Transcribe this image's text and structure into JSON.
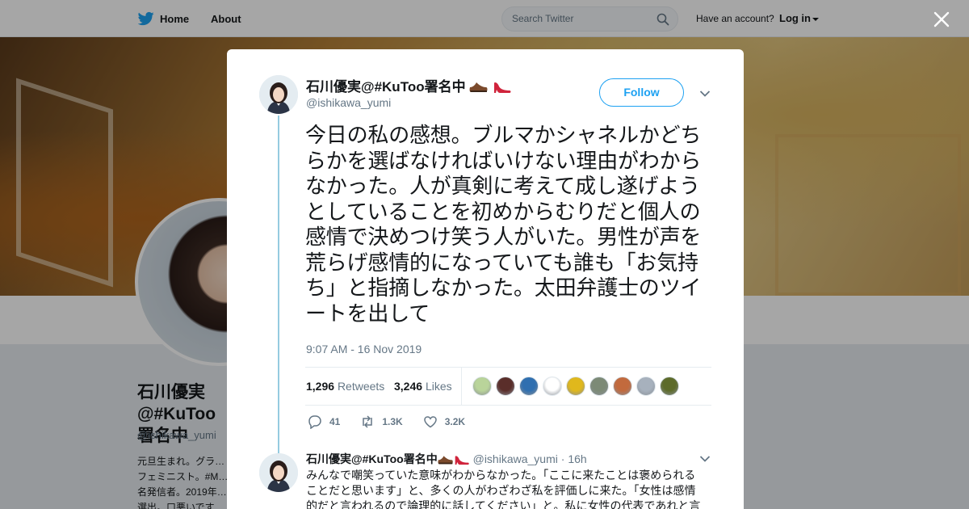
{
  "topbar": {
    "home_label": "Home",
    "about_label": "About",
    "search_placeholder": "Search Twitter",
    "have_account": "Have an account?",
    "login_label": "Log in"
  },
  "profile": {
    "name": "石川優実@#KuToo署名中",
    "handle": "@ishikawa_yumi",
    "bio": "元旦生まれ。グラ… フェミニスト。#M… 名発信者。2019年… 選出。口悪いです…"
  },
  "tweet": {
    "author_name": "石川優実@#KuToo署名中",
    "author_handle": "@ishikawa_yumi",
    "follow_label": "Follow",
    "text": "今日の私の感想。ブルマかシャネルかどちらかを選ばなければいけない理由がわからなかった。人が真剣に考えて成し遂げようとしていることを初めからむりだと個人の感情で決めつけ笑う人がいた。男性が声を荒らげ感情的になっていても誰も「お気持ち」と指摘しなかった。太田弁護士のツイートを出して",
    "timestamp": "9:07 AM - 16 Nov 2019",
    "retweets_count": "1,296",
    "retweets_label": "Retweets",
    "likes_count": "3,246",
    "likes_label": "Likes",
    "reply_count": "41",
    "retweet_action_count": "1.3K",
    "like_action_count": "3.2K",
    "likers": [
      "#b9d49a",
      "#5a2e2a",
      "#2f6fb0",
      "#ffffff",
      "#e0b81c",
      "#7c8a76",
      "#c26a3d",
      "#a7b1bd",
      "#5d6b2a"
    ]
  },
  "reply": {
    "author_name": "石川優実@#KuToo署名中",
    "author_handle": "@ishikawa_yumi",
    "time_ago": "16h",
    "separator": "·",
    "text": "みんなで嘲笑っていた意味がわからなかった。「ここに来たことは褒められることだと思います」と、多くの人がわざわざ私を評価しに来た。「女性は感情的だと言われるので論理的に話してください」と。私に女性の代表であれと言"
  },
  "colors": {
    "accent": "#1da1f2",
    "thread_line": "#95cbe0",
    "muted": "#657786",
    "text": "#14171a"
  },
  "icons": {
    "twitter": "twitter-bird-icon",
    "search": "search-icon",
    "close": "close-icon",
    "chevron": "chevron-down-icon",
    "reply": "reply-icon",
    "retweet": "retweet-icon",
    "like": "heart-icon",
    "shoe": "shoe-emoji",
    "heel": "high-heel-emoji"
  }
}
